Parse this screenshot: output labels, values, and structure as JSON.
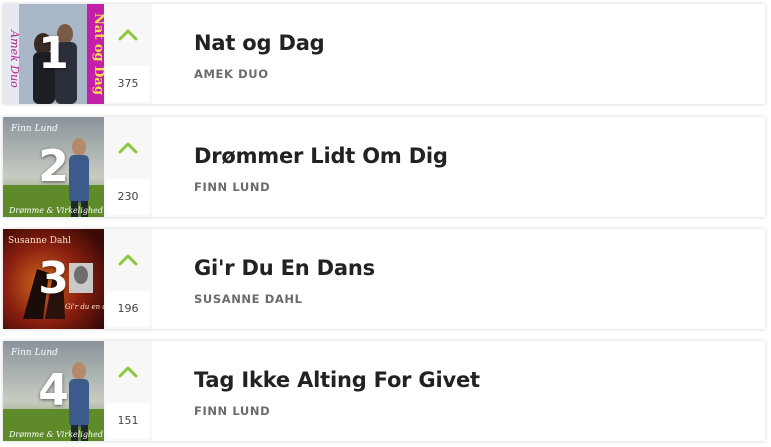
{
  "colors": {
    "trend_up": "#8cc63f",
    "title": "#222222",
    "artist": "#6b6b6b"
  },
  "entries": [
    {
      "rank": "1",
      "title": "Nat og Dag",
      "artist": "AMEK DUO",
      "count": "375",
      "trend_icon": "chevron-up-icon",
      "cover_text": "Nat og Dag"
    },
    {
      "rank": "2",
      "title": "Drømmer Lidt Om Dig",
      "artist": "FINN LUND",
      "count": "230",
      "trend_icon": "chevron-up-icon",
      "cover_text": "Finn Lund"
    },
    {
      "rank": "3",
      "title": "Gi'r Du En Dans",
      "artist": "SUSANNE DAHL",
      "count": "196",
      "trend_icon": "chevron-up-icon",
      "cover_text": "Susanne Dahl"
    },
    {
      "rank": "4",
      "title": "Tag Ikke Alting For Givet",
      "artist": "FINN LUND",
      "count": "151",
      "trend_icon": "chevron-up-icon",
      "cover_text": "Finn Lund"
    }
  ]
}
